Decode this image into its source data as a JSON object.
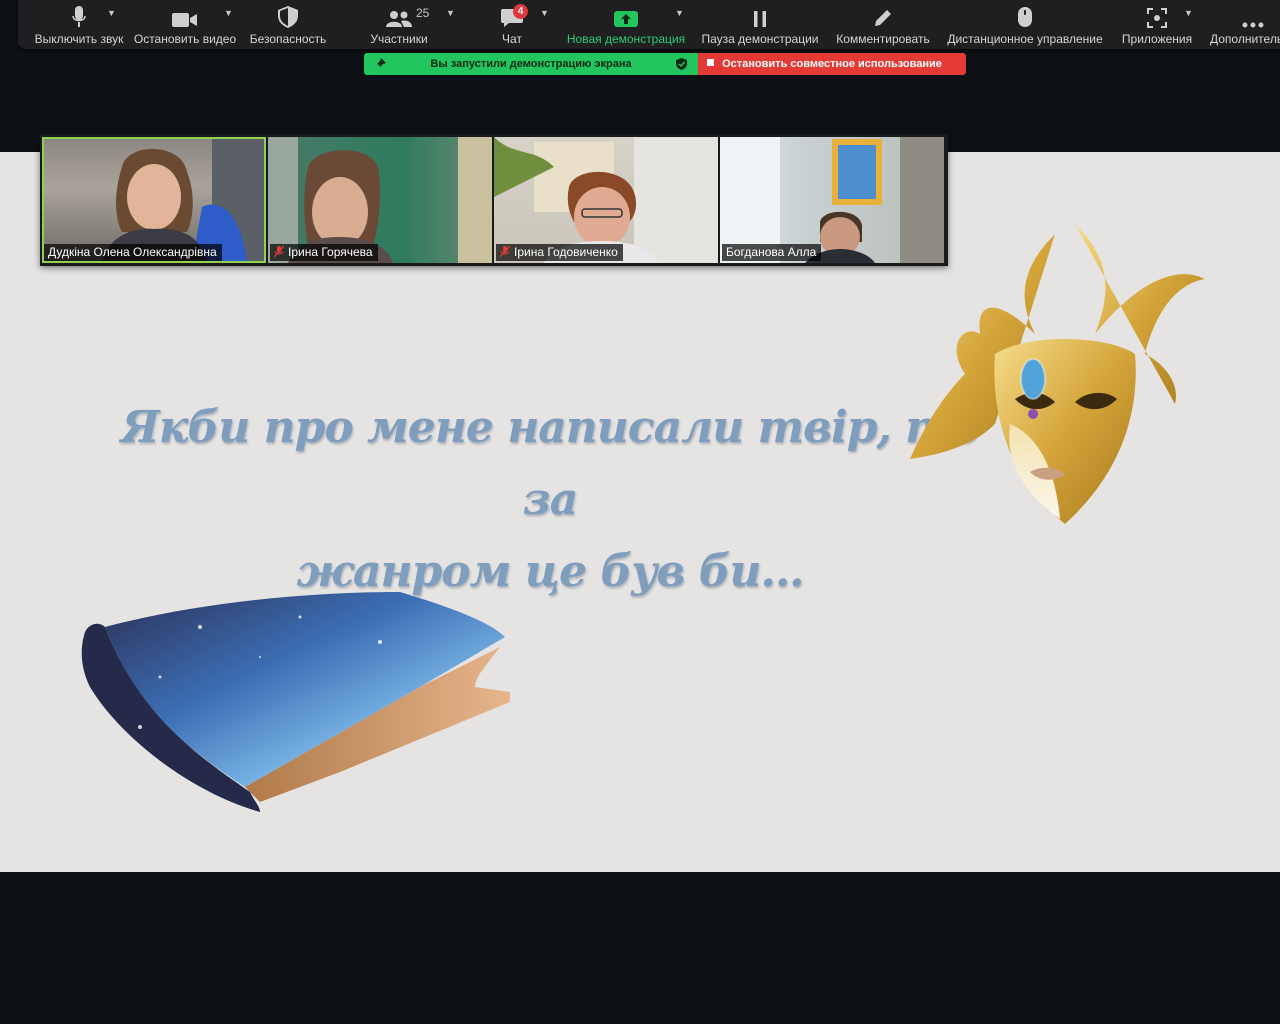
{
  "toolbar": {
    "mute": {
      "label": "Выключить звук"
    },
    "video": {
      "label": "Остановить видео"
    },
    "security": {
      "label": "Безопасность"
    },
    "participants": {
      "label": "Участники",
      "count": "25"
    },
    "chat": {
      "label": "Чат",
      "badge": "4"
    },
    "new_share": {
      "label": "Новая демонстрация"
    },
    "pause_share": {
      "label": "Пауза демонстрации"
    },
    "annotate": {
      "label": "Комментировать"
    },
    "remote_control": {
      "label": "Дистанционное управление"
    },
    "apps": {
      "label": "Приложения"
    },
    "more": {
      "label": "Дополнительно"
    }
  },
  "share_banner": {
    "status_text": "Вы запустили демонстрацию экрана",
    "stop_text": "Остановить совместное использование"
  },
  "participants": [
    {
      "name": "Дудкіна Олена Олександрівна",
      "muted": false
    },
    {
      "name": "Ірина Горячева",
      "muted": true
    },
    {
      "name": "Ірина Годовиченко",
      "muted": true
    },
    {
      "name": "Богданова Алла",
      "muted": false
    }
  ],
  "slide": {
    "line1": "Якби про мене написали твір, то за",
    "line2": "жанром це був би..."
  },
  "colors": {
    "share_green": "#22c55e",
    "share_red": "#e33a35",
    "slide_text": "#7f9dbd",
    "active_speaker": "#8fd14f"
  }
}
